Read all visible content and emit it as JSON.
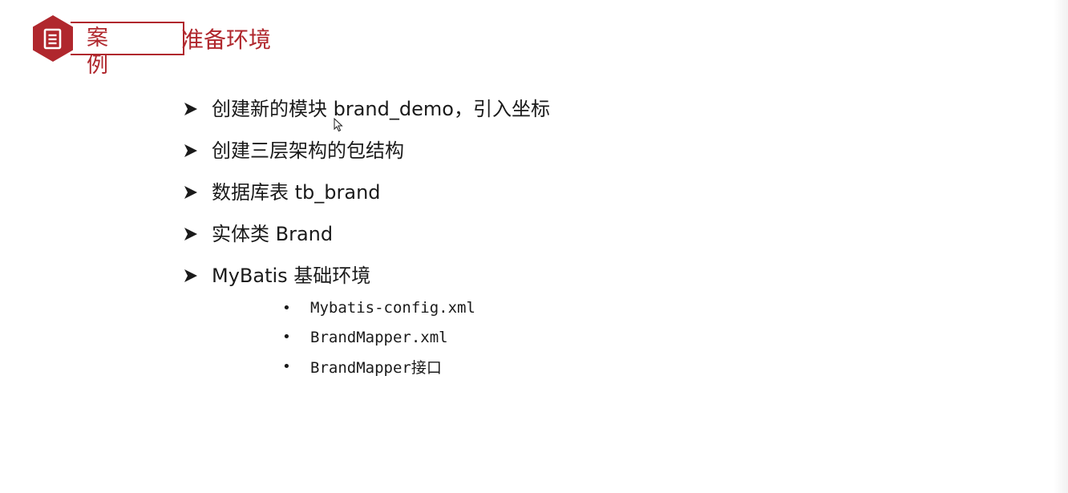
{
  "header": {
    "tag_label": "案例",
    "title": "准备环境",
    "badge_icon": "document-icon",
    "accent_color": "#b0272d"
  },
  "bullets": [
    {
      "text": "创建新的模块 brand_demo，引入坐标"
    },
    {
      "text": "创建三层架构的包结构"
    },
    {
      "text": "数据库表 tb_brand"
    },
    {
      "text": "实体类 Brand"
    },
    {
      "text": "MyBatis 基础环境"
    }
  ],
  "sub_bullets": [
    {
      "text": "Mybatis-config.xml"
    },
    {
      "text": "BrandMapper.xml"
    },
    {
      "text": "BrandMapper接口"
    }
  ]
}
